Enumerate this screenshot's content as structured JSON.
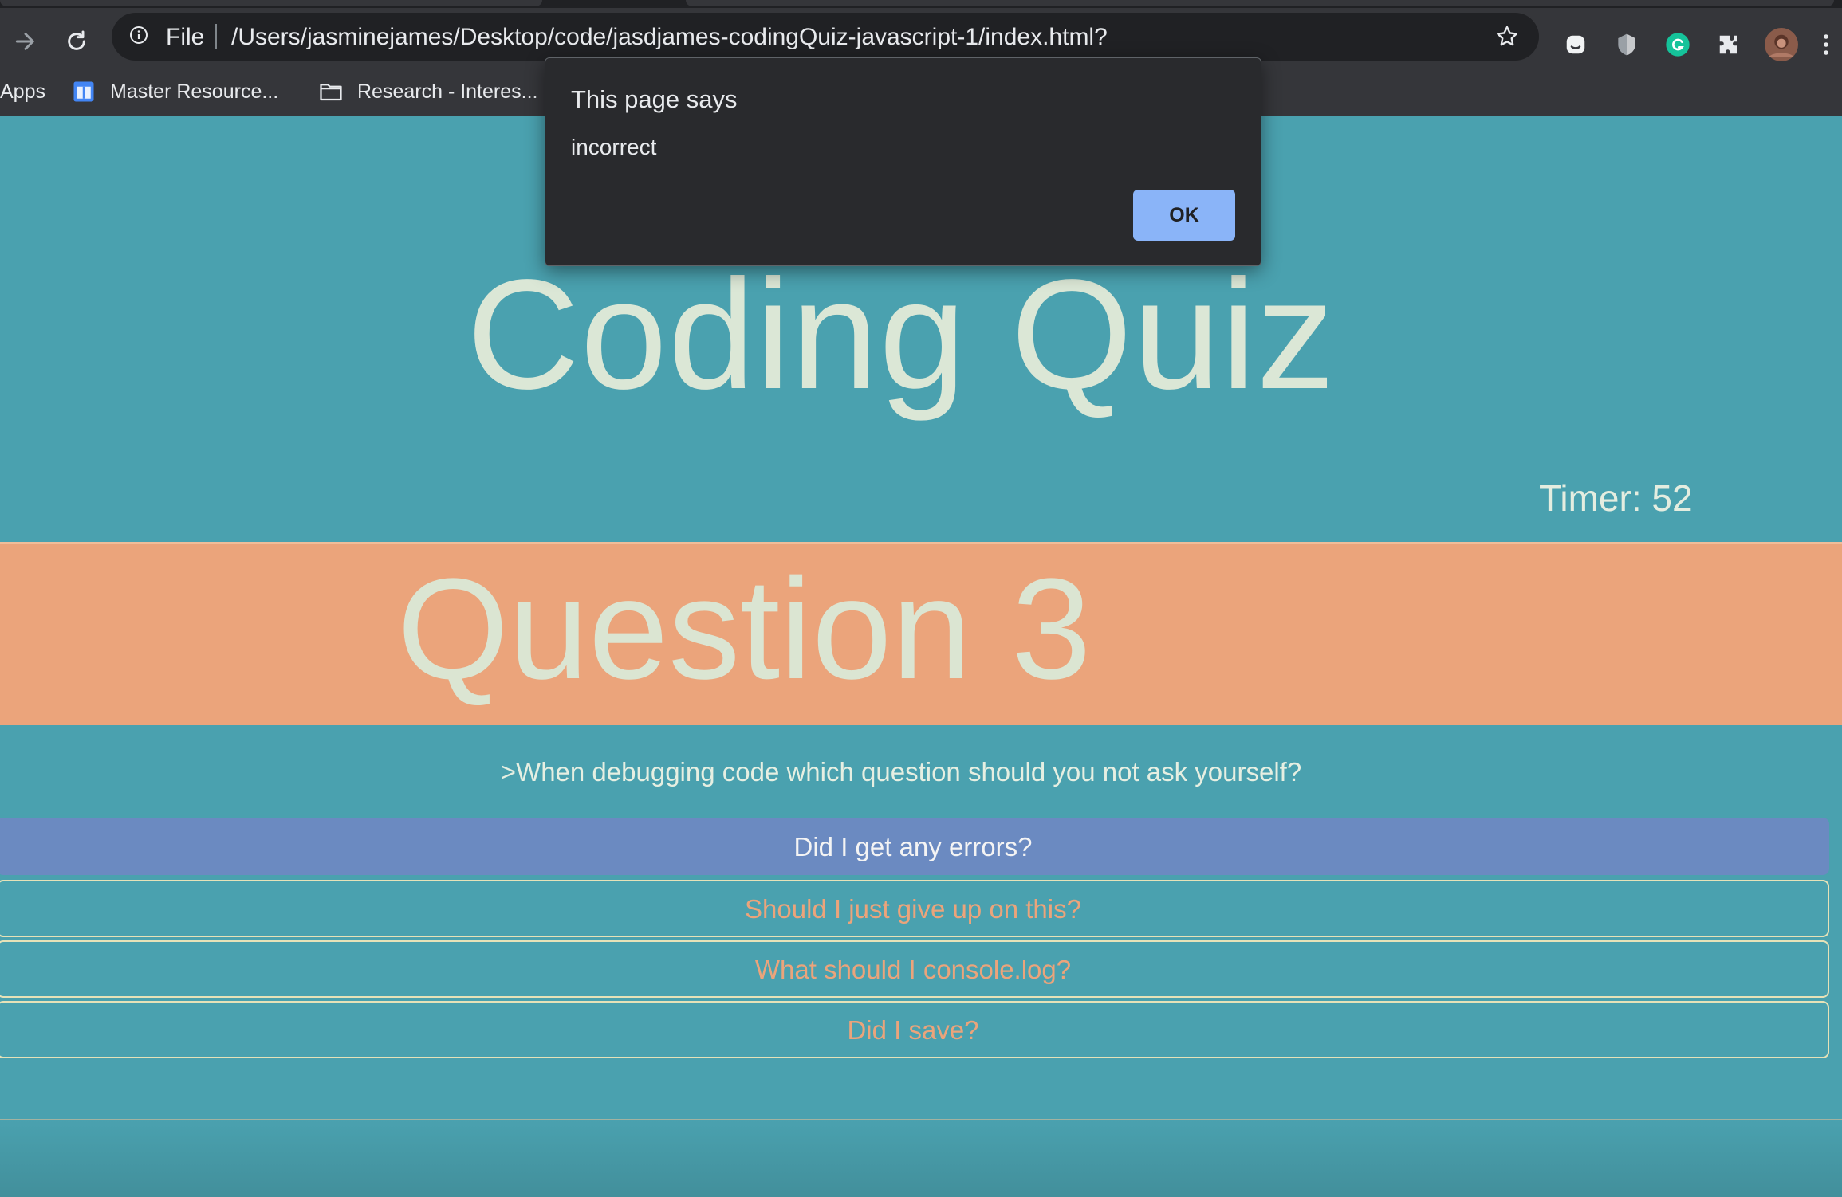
{
  "browser": {
    "scheme_label": "File",
    "url": "/Users/jasminejames/Desktop/code/jasdjames-codingQuiz-javascript-1/index.html?",
    "bookmarks": [
      {
        "label": "Apps",
        "icon": "apps-icon"
      },
      {
        "label": "Master Resource...",
        "icon": "sheets-icon"
      },
      {
        "label": "Research - Interes...",
        "icon": "folder-icon"
      }
    ],
    "extensions": [
      "ghost-extension-icon",
      "shield-extension-icon",
      "grammarly-icon",
      "puzzle-extensions-icon",
      "profile-avatar"
    ]
  },
  "dialog": {
    "title": "This page says",
    "message": "incorrect",
    "ok_label": "OK"
  },
  "page": {
    "title": "Coding Quiz",
    "timer": "Timer: 52",
    "question_heading": "Question 3",
    "question_text": ">When debugging code which question should you not ask yourself?",
    "answers": [
      "Did I get any errors?",
      "Should I just give up on this?",
      "What should I console.log?",
      "Did I save?"
    ],
    "selected_answer_index": 0
  },
  "colors": {
    "background": "#4aa1af",
    "banner": "#eba47b",
    "selected_answer": "#6b8ac1",
    "answer_text": "#eba47b",
    "title_text": "#dbe7d6",
    "dialog_bg": "#292a2d",
    "ok_button": "#8ab4f8"
  }
}
